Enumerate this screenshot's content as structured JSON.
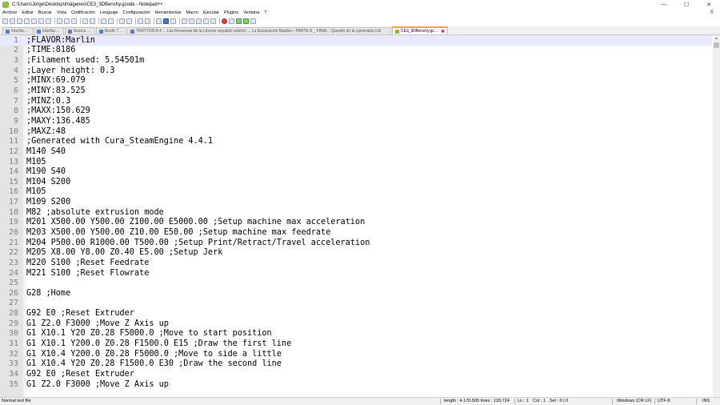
{
  "window": {
    "title": "C:\\Users\\Jorge\\Desktop\\Imágenes\\CE3_3DBenchy.gcode - Notepad++",
    "minimize": "—",
    "maximize": "☐",
    "close": "✕"
  },
  "menu": {
    "items": [
      "Archivo",
      "Editar",
      "Buscar",
      "Vista",
      "Codificación",
      "Lenguaje",
      "Configuración",
      "Herramientas",
      "Macro",
      "Ejecutar",
      "Plugins",
      "Ventana",
      "?"
    ],
    "close_doc": "X"
  },
  "tabs": [
    {
      "label": "Interfaces.dll"
    },
    {
      "label": "Interfaces.dll"
    },
    {
      "label": "Acerca del"
    },
    {
      "label": "Booth 7.0.dll"
    },
    {
      "label": "TRATTOICA 4 ... Las Revanvas de la Lincore requisito edición ... La Excavación Maidon - PARTE 8 _ FINAL - Questin do la cjeneratos Ltd"
    },
    {
      "label": "CE3_3DBenchy.gcode",
      "active": true
    }
  ],
  "editor": {
    "current_line": 1,
    "lines": [
      ";FLAVOR:Marlin",
      ";TIME:8186",
      ";Filament used: 5.54501m",
      ";Layer height: 0.3",
      ";MINX:69.079",
      ";MINY:83.525",
      ";MINZ:0.3",
      ";MAXX:150.629",
      ";MAXY:136.485",
      ";MAXZ:48",
      ";Generated with Cura_SteamEngine 4.4.1",
      "M140 S40",
      "M105",
      "M190 S40",
      "M104 S200",
      "M105",
      "M109 S200",
      "M82 ;absolute extrusion mode",
      "M201 X500.00 Y500.00 Z100.00 E5000.00 ;Setup machine max acceleration",
      "M203 X500.00 Y500.00 Z10.00 E50.00 ;Setup machine max feedrate",
      "M204 P500.00 R1000.00 T500.00 ;Setup Print/Retract/Travel acceleration",
      "M205 X8.00 Y8.00 Z0.40 E5.00 ;Setup Jerk",
      "M220 S100 ;Reset Feedrate",
      "M221 S100 ;Reset Flowrate",
      "",
      "G28 ;Home",
      "",
      "G92 E0 ;Reset Extruder",
      "G1 Z2.0 F3000 ;Move Z Axis up",
      "G1 X10.1 Y20 Z0.28 F5000.0 ;Move to start position",
      "G1 X10.1 Y200.0 Z0.28 F1500.0 E15 ;Draw the first line",
      "G1 X10.4 Y200.0 Z0.28 F5000.0 ;Move to side a little",
      "G1 X10.4 Y20 Z0.28 F1500.0 E30 ;Draw the second line",
      "G92 E0 ;Reset Extruder",
      "G1 Z2.0 F3000 ;Move Z Axis up"
    ]
  },
  "status": {
    "file_type": "Normal text file",
    "length": "length : 4.170.505",
    "lines": "lines : 133.724",
    "ln": "Ln : 1",
    "col": "Col : 1",
    "sel": "Sel : 0 | 0",
    "eol": "Windows (CR LF)",
    "encoding": "UTF-8",
    "mode": "INS"
  },
  "colors": {
    "current_line_bg": "#e8e8ff",
    "gutter_bg": "#e4e4e4",
    "active_tab_accent": "#f5a623",
    "line_number": "#808080"
  }
}
